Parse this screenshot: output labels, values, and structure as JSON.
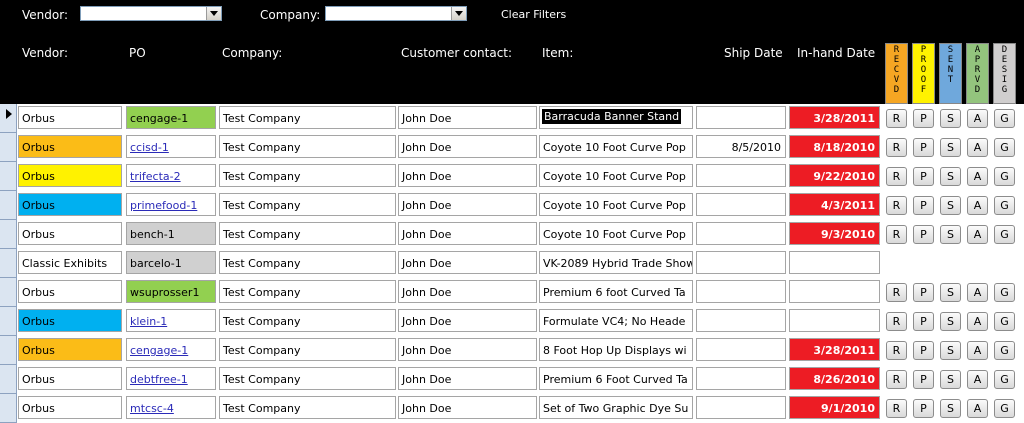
{
  "filters": {
    "vendor_label": "Vendor:",
    "company_label": "Company:",
    "vendor_value": "",
    "company_value": "",
    "clear_label": "Clear Filters"
  },
  "columns": {
    "vendor": "Vendor:",
    "po": "PO",
    "company": "Company:",
    "contact": "Customer contact:",
    "item": "Item:",
    "ship_date": "Ship Date",
    "inhand_date": "In-hand Date"
  },
  "status_columns": [
    {
      "letters": [
        "R",
        "E",
        "C",
        "V",
        "D"
      ],
      "color": "#f5a623"
    },
    {
      "letters": [
        "P",
        "R",
        "O",
        "O",
        "F"
      ],
      "color": "#fff200"
    },
    {
      "letters": [
        "S",
        "E",
        "N",
        "T"
      ],
      "color": "#6fa8dc"
    },
    {
      "letters": [
        "A",
        "P",
        "R",
        "V",
        "D"
      ],
      "color": "#93c47d"
    },
    {
      "letters": [
        "D",
        "E",
        "S",
        "I",
        "G"
      ],
      "color": "#d0cece"
    }
  ],
  "colors": {
    "orange": "#fbbc17",
    "yellow": "#fff200",
    "blue": "#00b0f0",
    "green": "#92d050",
    "gray": "#d0d0d0",
    "red": "#ed1c24"
  },
  "status_button_labels": [
    "R",
    "P",
    "S",
    "A",
    "G"
  ],
  "rows": [
    {
      "vendor": "Orbus",
      "vendor_color": "",
      "po": "cengage-1",
      "po_link": false,
      "po_color": "green",
      "company": "Test Company",
      "contact": "John Doe",
      "item": "Barracuda Banner Stand",
      "item_selected": true,
      "ship_date": "",
      "inhand_date": "3/28/2011",
      "inhand_red": true,
      "buttons": true,
      "current": true
    },
    {
      "vendor": "Orbus",
      "vendor_color": "orange",
      "po": "ccisd-1",
      "po_link": true,
      "po_color": "",
      "company": "Test Company",
      "contact": "John Doe",
      "item": "Coyote 10 Foot Curve Pop",
      "item_selected": false,
      "ship_date": "8/5/2010",
      "inhand_date": "8/18/2010",
      "inhand_red": true,
      "buttons": true,
      "current": false
    },
    {
      "vendor": "Orbus",
      "vendor_color": "yellow",
      "po": "trifecta-2",
      "po_link": true,
      "po_color": "",
      "company": "Test Company",
      "contact": "John Doe",
      "item": "Coyote 10 Foot Curve Pop",
      "item_selected": false,
      "ship_date": "",
      "inhand_date": "9/22/2010",
      "inhand_red": true,
      "buttons": true,
      "current": false
    },
    {
      "vendor": "Orbus",
      "vendor_color": "blue",
      "po": "primefood-1",
      "po_link": true,
      "po_color": "",
      "company": "Test Company",
      "contact": "John Doe",
      "item": "Coyote 10 Foot Curve Pop",
      "item_selected": false,
      "ship_date": "",
      "inhand_date": "4/3/2011",
      "inhand_red": true,
      "buttons": true,
      "current": false
    },
    {
      "vendor": "Orbus",
      "vendor_color": "",
      "po": "bench-1",
      "po_link": false,
      "po_color": "gray",
      "company": "Test Company",
      "contact": "John Doe",
      "item": "Coyote 10 Foot Curve Pop",
      "item_selected": false,
      "ship_date": "",
      "inhand_date": "9/3/2010",
      "inhand_red": true,
      "buttons": true,
      "current": false
    },
    {
      "vendor": "Classic Exhibits",
      "vendor_color": "",
      "po": "barcelo-1",
      "po_link": false,
      "po_color": "gray",
      "company": "Test Company",
      "contact": "John Doe",
      "item": "VK-2089 Hybrid Trade Show",
      "item_selected": false,
      "ship_date": "",
      "inhand_date": "",
      "inhand_red": false,
      "buttons": false,
      "current": false
    },
    {
      "vendor": "Orbus",
      "vendor_color": "",
      "po": "wsuprosser1",
      "po_link": false,
      "po_color": "green",
      "company": "Test Company",
      "contact": "John Doe",
      "item": "Premium 6 foot Curved Ta",
      "item_selected": false,
      "ship_date": "",
      "inhand_date": "",
      "inhand_red": false,
      "buttons": true,
      "current": false
    },
    {
      "vendor": "Orbus",
      "vendor_color": "blue",
      "po": "klein-1",
      "po_link": true,
      "po_color": "",
      "company": "Test Company",
      "contact": "John Doe",
      "item": "Formulate VC4; No Heade",
      "item_selected": false,
      "ship_date": "",
      "inhand_date": "",
      "inhand_red": false,
      "buttons": true,
      "current": false
    },
    {
      "vendor": "Orbus",
      "vendor_color": "orange",
      "po": "cengage-1",
      "po_link": true,
      "po_color": "",
      "company": "Test Company",
      "contact": "John Doe",
      "item": "8 Foot Hop Up Displays wi",
      "item_selected": false,
      "ship_date": "",
      "inhand_date": "3/28/2011",
      "inhand_red": true,
      "buttons": true,
      "current": false
    },
    {
      "vendor": "Orbus",
      "vendor_color": "",
      "po": "debtfree-1",
      "po_link": true,
      "po_color": "",
      "company": "Test Company",
      "contact": "John Doe",
      "item": "Premium 6 Foot Curved Ta",
      "item_selected": false,
      "ship_date": "",
      "inhand_date": "8/26/2010",
      "inhand_red": true,
      "buttons": true,
      "current": false
    },
    {
      "vendor": "Orbus",
      "vendor_color": "",
      "po": "mtcsc-4",
      "po_link": true,
      "po_color": "",
      "company": "Test Company",
      "contact": "John Doe",
      "item": "Set of Two Graphic Dye Su",
      "item_selected": false,
      "ship_date": "",
      "inhand_date": "9/1/2010",
      "inhand_red": true,
      "buttons": true,
      "current": false
    }
  ]
}
